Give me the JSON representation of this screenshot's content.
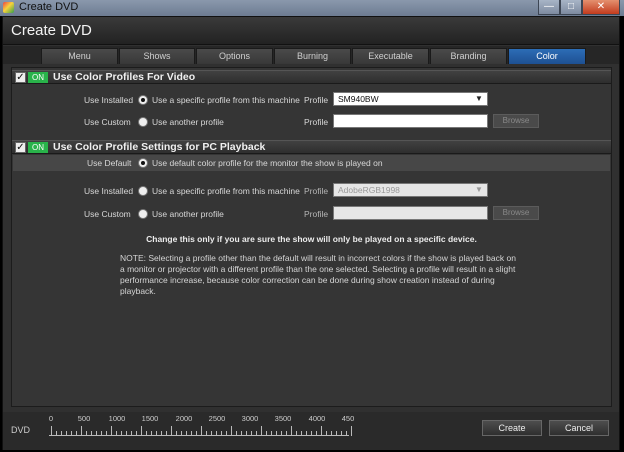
{
  "titlebar": {
    "title": "Create DVD",
    "minimize": "—",
    "maximize": "□",
    "close": "✕"
  },
  "window": {
    "header_title": "Create DVD"
  },
  "tabs": [
    {
      "label": "Menu"
    },
    {
      "label": "Shows"
    },
    {
      "label": "Options"
    },
    {
      "label": "Burning"
    },
    {
      "label": "Executable"
    },
    {
      "label": "Branding"
    },
    {
      "label": "Color"
    }
  ],
  "video_section": {
    "on_badge": "ON",
    "title": "Use Color Profiles For Video",
    "row1": {
      "label": "Use Installed",
      "radio_label": "Use a specific profile from this machine",
      "profile_label": "Profile",
      "profile_value": "SM940BW"
    },
    "row2": {
      "label": "Use Custom",
      "radio_label": "Use another profile",
      "profile_label": "Profile",
      "profile_value": "",
      "browse": "Browse"
    }
  },
  "pc_section": {
    "on_badge": "ON",
    "title": "Use Color Profile Settings for PC Playback",
    "row0": {
      "label": "Use Default",
      "radio_label": "Use default color profile for the monitor the show is played on"
    },
    "row1": {
      "label": "Use Installed",
      "radio_label": "Use a specific profile from this machine",
      "profile_label": "Profile",
      "profile_value": "AdobeRGB1998"
    },
    "row2": {
      "label": "Use Custom",
      "radio_label": "Use another profile",
      "profile_label": "Profile",
      "profile_value": "",
      "browse": "Browse"
    },
    "warning": "Change this only if you are sure the show will only be played on a specific device.",
    "note": "NOTE: Selecting a profile other than the default will result in incorrect colors if the show is played back on a monitor or projector with a different profile than the one selected. Selecting a profile will result in a slight performance increase, because color correction can be done during show creation instead of during playback."
  },
  "bottom": {
    "dvd_label": "DVD",
    "ruler_ticks": [
      "0",
      "500",
      "1000",
      "1500",
      "2000",
      "2500",
      "3000",
      "3500",
      "4000",
      "450"
    ],
    "create": "Create",
    "cancel": "Cancel"
  },
  "colors": {
    "accent_tab": "#2c6db6",
    "on_badge": "#29b34a",
    "background": "#303030"
  }
}
